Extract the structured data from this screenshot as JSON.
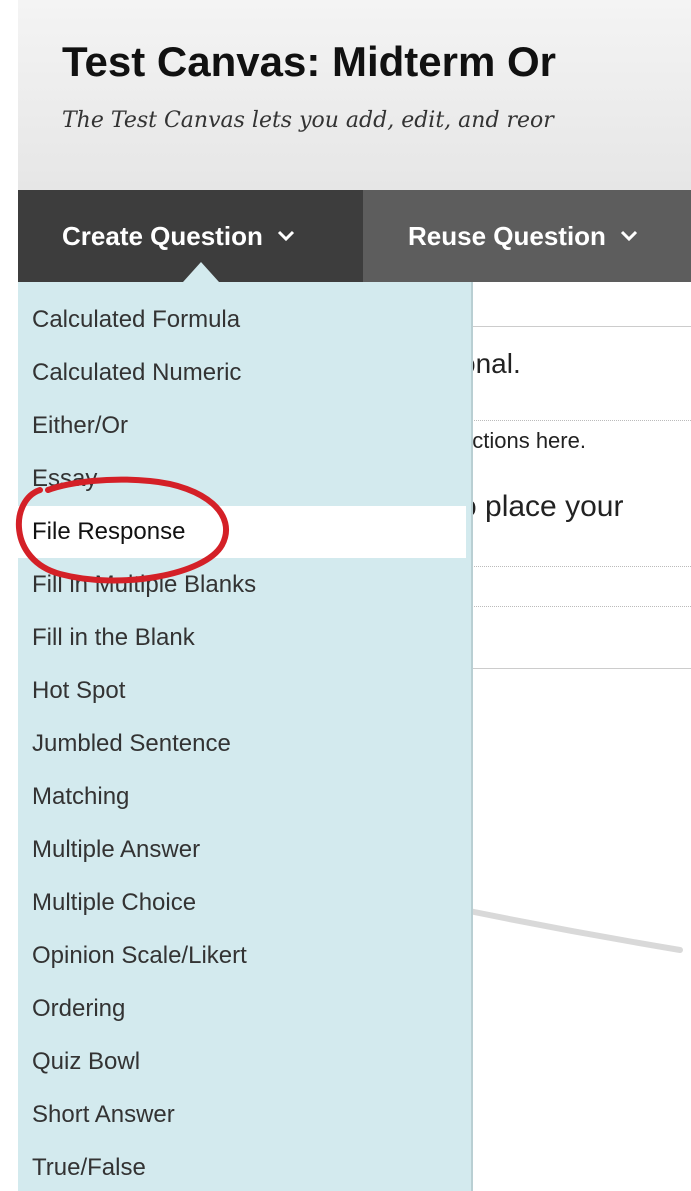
{
  "header": {
    "title": "Test Canvas: Midterm Or",
    "subtitle": "The Test Canvas lets you add, edit, and reor"
  },
  "action_bar": {
    "create_label": "Create Question",
    "reuse_label": "Reuse Question"
  },
  "background_text": {
    "line1": "onal.",
    "line2": "uctions here.",
    "line3": "o place your"
  },
  "menu": {
    "items": [
      "Calculated Formula",
      "Calculated Numeric",
      "Either/Or",
      "Essay",
      "File Response",
      "Fill in Multiple Blanks",
      "Fill in the Blank",
      "Hot Spot",
      "Jumbled Sentence",
      "Matching",
      "Multiple Answer",
      "Multiple Choice",
      "Opinion Scale/Likert",
      "Ordering",
      "Quiz Bowl",
      "Short Answer",
      "True/False"
    ],
    "highlighted_item": "File Response"
  },
  "colors": {
    "menu_background": "#d3eaee",
    "action_bar": "#5d5d5d",
    "active_tab": "#3d3d3d",
    "annotation_circle": "#d42027"
  },
  "icons": {
    "dropdown": "chevron-down-icon"
  }
}
